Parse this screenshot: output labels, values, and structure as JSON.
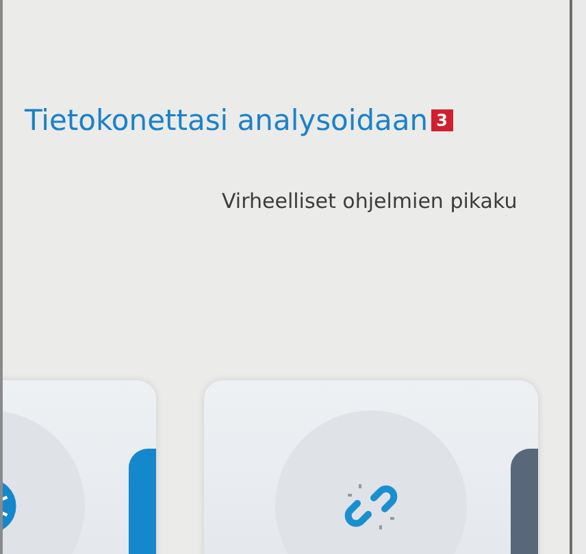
{
  "heading": {
    "title": "Tietokonettasi analysoidaan",
    "callout": "3"
  },
  "subtitle": "Virheelliset ohjelmien pikaku",
  "cards": [
    {
      "kind": "globe",
      "color": "#1587cc"
    },
    {
      "kind": "broken-link",
      "color": "#58677a"
    }
  ]
}
